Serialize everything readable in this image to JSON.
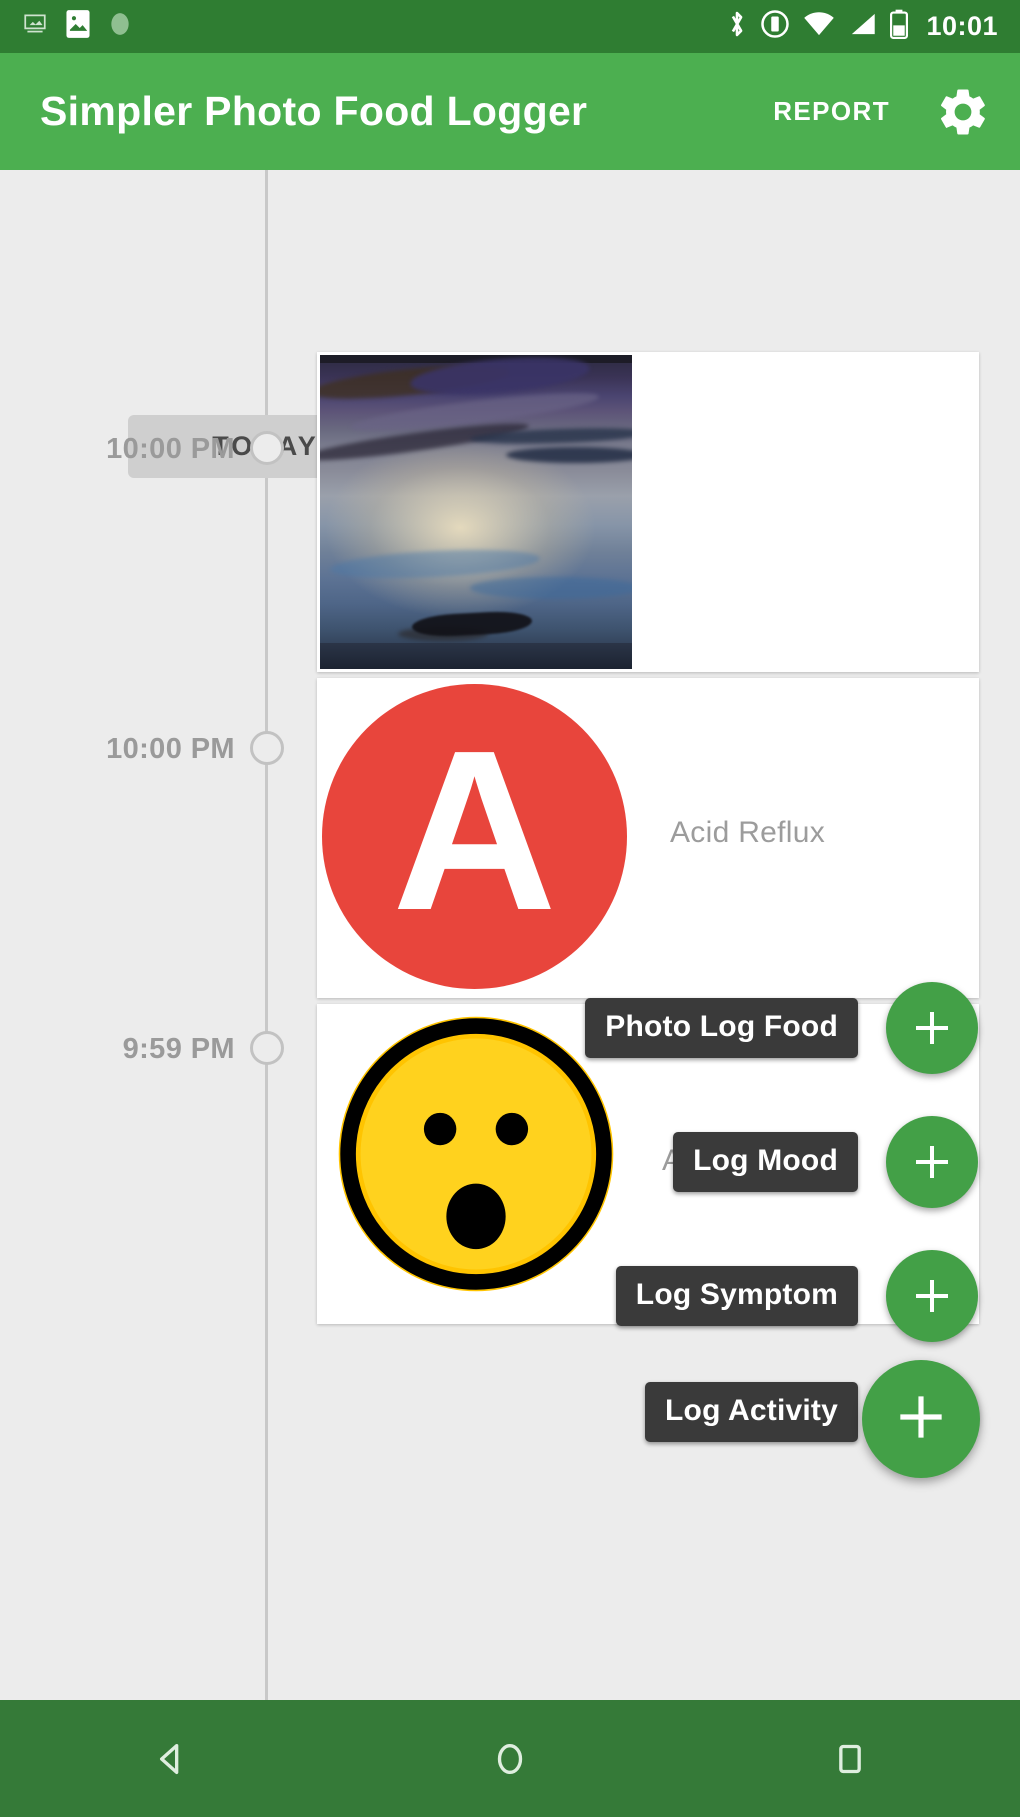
{
  "status_bar": {
    "time": "10:01",
    "icons": [
      "image-download-icon",
      "photo-icon",
      "dot-icon",
      "bluetooth-icon",
      "do-not-disturb-icon",
      "wifi-icon",
      "cellular-signal-icon",
      "battery-icon"
    ]
  },
  "app_bar": {
    "title": "Simpler Photo Food Logger",
    "report_label": "REPORT",
    "settings_icon": "gear-icon",
    "background_color": "#4caf50"
  },
  "timeline": {
    "day_chip": "TODAY",
    "entries": [
      {
        "time": "10:00 PM",
        "type": "photo",
        "label": "",
        "thumbnail": "food-photo-thumbnail"
      },
      {
        "time": "10:00 PM",
        "type": "symptom",
        "label": "Acid Reflux",
        "avatar_letter": "A",
        "avatar_color": "#e8453c"
      },
      {
        "time": "9:59 PM",
        "type": "mood",
        "label": "Amazed",
        "emoji": "amazed-face-emoji",
        "emoji_color": "#ffc107"
      }
    ]
  },
  "speed_dial": {
    "expanded": true,
    "main_fab": {
      "icon": "plus-icon",
      "color": "#43a047"
    },
    "actions": [
      {
        "label": "Photo Log Food",
        "icon": "plus-icon"
      },
      {
        "label": "Log Mood",
        "icon": "plus-icon"
      },
      {
        "label": "Log Symptom",
        "icon": "plus-icon"
      },
      {
        "label": "Log Activity",
        "icon": "plus-icon"
      }
    ]
  },
  "nav_bar": {
    "back": "back-triangle-icon",
    "home": "home-circle-icon",
    "recents": "recents-square-icon",
    "background_color": "#357a38"
  }
}
